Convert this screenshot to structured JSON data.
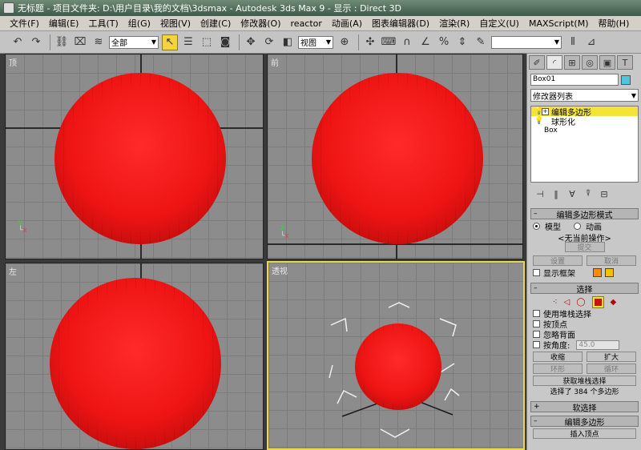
{
  "window": {
    "title": "无标题    - 项目文件夹: D:\\用户目录\\我的文档\\3dsmax    - Autodesk 3ds Max 9    - 显示 : Direct 3D"
  },
  "menu": [
    "文件(F)",
    "编辑(E)",
    "工具(T)",
    "组(G)",
    "视图(V)",
    "创建(C)",
    "修改器(O)",
    "reactor",
    "动画(A)",
    "图表编辑器(D)",
    "渲染(R)",
    "自定义(U)",
    "MAXScript(M)",
    "帮助(H)"
  ],
  "toolbar": {
    "selection_filter": "全部",
    "reference_coord": "视图",
    "named_selection": ""
  },
  "viewports": {
    "top": {
      "label": "顶"
    },
    "front": {
      "label": "前"
    },
    "left": {
      "label": "左"
    },
    "perspective": {
      "label": "透视"
    }
  },
  "command_panel": {
    "object_name": "Box01",
    "object_color": "#4fc6e0",
    "modifier_list": "修改器列表",
    "stack": [
      {
        "label": "编辑多边形",
        "selected": true
      },
      {
        "label": "球形化",
        "selected": false
      },
      {
        "label": "Box",
        "selected": false
      }
    ],
    "edit_poly_mode": {
      "header": "编辑多边形模式",
      "model_label": "模型",
      "animate_label": "动画",
      "no_op": "<无当前操作>",
      "commit": "提交",
      "settings": "设置",
      "cancel": "取消",
      "show_cage": "显示框架",
      "cage_color_1": "#ff8c00",
      "cage_color_2": "#f5c200"
    },
    "selection": {
      "header": "选择",
      "use_stack": "使用堆栈选择",
      "by_vertex": "按顶点",
      "ignore_backfacing": "忽略背面",
      "by_angle": "按角度:",
      "angle_value": "45.0",
      "shrink": "收缩",
      "grow": "扩大",
      "ring": "环形",
      "loop": "循环",
      "get_stack": "获取堆栈选择",
      "status": "选择了 384 个多边形"
    },
    "soft_selection": {
      "header": "软选择"
    },
    "edit_polygons": {
      "header": "编辑多边形",
      "insert_vertex": "插入顶点"
    }
  }
}
